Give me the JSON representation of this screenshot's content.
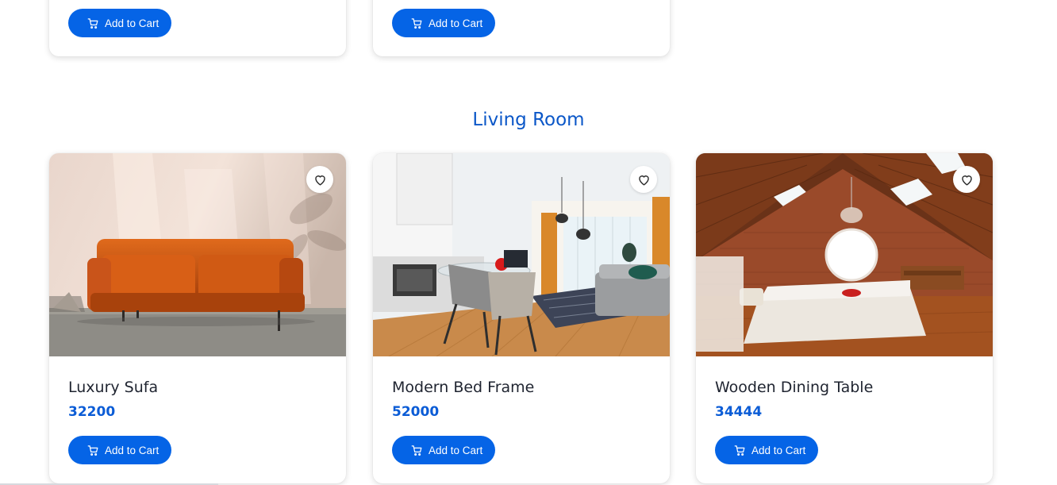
{
  "colors": {
    "accent": "#0564e6",
    "section_title": "#0b57c8",
    "price": "#0b5cd6"
  },
  "top_row": {
    "cards": [
      {
        "button_label": "Add to Cart"
      },
      {
        "button_label": "Add to Cart"
      }
    ]
  },
  "section": {
    "title": "Living Room",
    "products": [
      {
        "name": "Luxury Sufa",
        "price": "32200",
        "button_label": "Add to Cart",
        "image": "orange-leather-sofa-photo",
        "favorite_icon": "heart-outline-icon"
      },
      {
        "name": "Modern Bed Frame",
        "price": "52000",
        "button_label": "Add to Cart",
        "image": "modern-open-kitchen-living-room-photo",
        "favorite_icon": "heart-outline-icon"
      },
      {
        "name": "Wooden Dining Table",
        "price": "34444",
        "button_label": "Add to Cart",
        "image": "attic-wooden-bedroom-photo",
        "favorite_icon": "heart-outline-icon"
      }
    ]
  }
}
